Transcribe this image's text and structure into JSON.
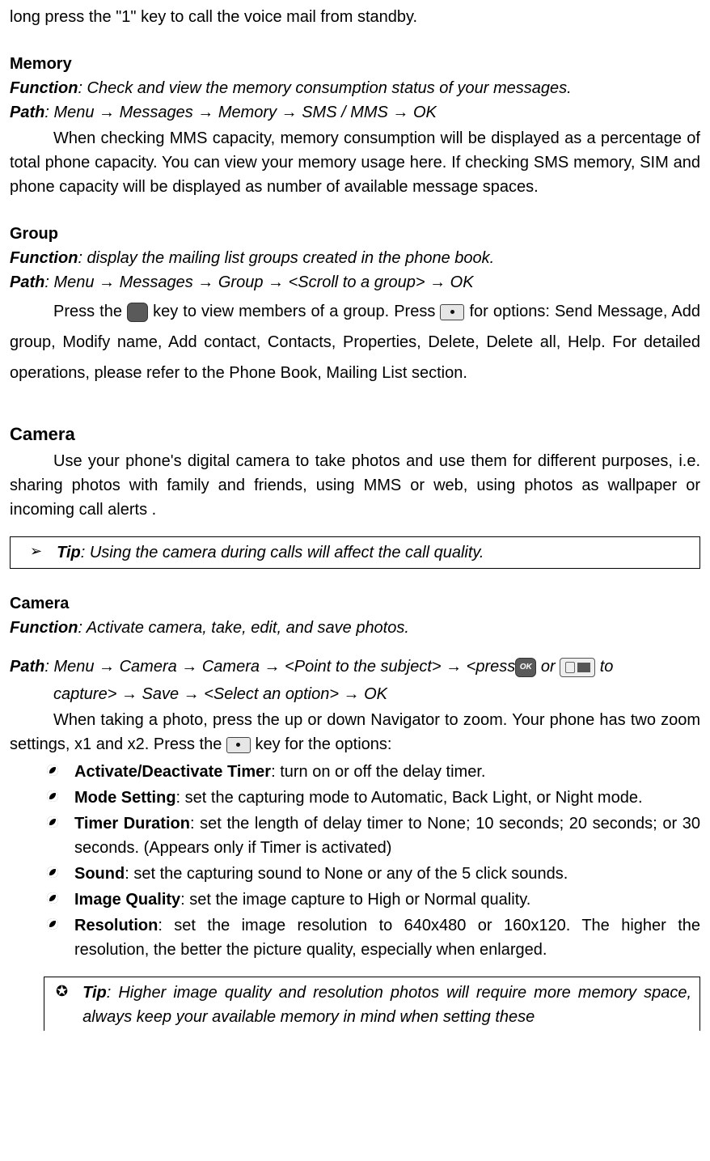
{
  "intro_line": "long press the \"1\" key to call the voice mail from standby.",
  "memory": {
    "title": "Memory",
    "function": ": Check and view the memory consumption status of your messages.",
    "path": ": Menu → Messages → Memory → SMS / MMS → OK",
    "para": "When checking MMS capacity, memory consumption will be displayed as a percentage of total phone capacity. You can view your memory usage here. If checking SMS memory, SIM and phone capacity will be displayed as number of available message spaces."
  },
  "group": {
    "title": "Group",
    "function": ": display the mailing list groups created in the phone book.",
    "path": ": Menu → Messages → Group → <Scroll to a group> → OK",
    "para_a": "Press the ",
    "para_b": " key to view members of a group. Press ",
    "para_c": " for options: Send Message, Add group, Modify name, Add contact, Contacts, Properties, Delete, Delete all, Help. For detailed operations, please refer to the Phone Book, Mailing List section."
  },
  "camera": {
    "big_title": "Camera",
    "intro": "Use your phone's digital camera to take photos and use them for different purposes, i.e. sharing photos with family and friends, using MMS or web, using photos as wallpaper or incoming call alerts .",
    "tip1": ": Using the camera during calls will affect the call quality.",
    "sub_title": "Camera",
    "function": ": Activate camera, take, edit, and save photos.",
    "path_a": ": Menu → Camera → Camera → <Point to the subject> → <press",
    "path_mid": "  or ",
    "path_b": " to",
    "path_cont": "capture> → Save → <Select an option> → OK",
    "zoom_a": "When taking a photo, press the up or down Navigator to zoom. Your phone has two zoom settings, x1 and x2. Press the ",
    "zoom_b": " key for the options:",
    "bullets": [
      {
        "term": "Activate/Deactivate Timer",
        "rest": ": turn on or off the delay timer."
      },
      {
        "term": "Mode Setting",
        "rest": ": set the capturing mode to Automatic, Back Light, or Night mode."
      },
      {
        "term": "Timer Duration",
        "rest": ": set the length of delay timer to None; 10 seconds; 20 seconds; or 30 seconds. (Appears only if Timer is activated)"
      },
      {
        "term": "Sound",
        "rest": ": set the capturing sound to None or any of the 5 click sounds."
      },
      {
        "term": "Image Quality",
        "rest": ": set the image capture to High or Normal quality."
      },
      {
        "term": "Resolution",
        "rest": ": set the image resolution to 640x480 or 160x120. The higher the resolution, the better the picture quality, especially when enlarged."
      }
    ],
    "tip2": ": Higher image quality and resolution photos will require more memory space, always keep your available memory in mind when setting these"
  },
  "labels": {
    "function": "Function",
    "path": "Path",
    "tip": "Tip",
    "ok": "OK"
  }
}
